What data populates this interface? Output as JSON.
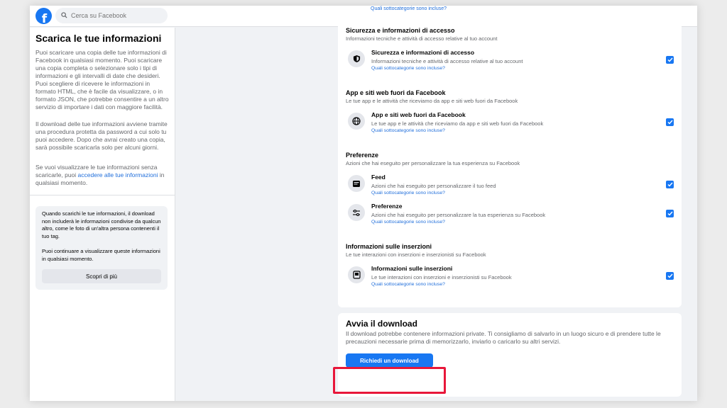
{
  "header": {
    "logo_letter": "f",
    "search_placeholder": "Cerca su Facebook",
    "nav_icons": [
      "home-icon",
      "watch-icon",
      "marketplace-icon",
      "groups-icon"
    ]
  },
  "sidebar": {
    "title": "Scarica le tue informazioni",
    "paragraph1": "Puoi scaricare una copia delle tue informazioni di Facebook in qualsiasi momento. Puoi scaricare una copia completa o selezionare solo i tipi di informazioni e gli intervalli di date che desideri. Puoi scegliere di ricevere le informazioni in formato HTML, che è facile da visualizzare, o in formato JSON, che potrebbe consentire a un altro servizio di importare i dati con maggiore facilità.",
    "paragraph2": "Il download delle tue informazioni avviene tramite una procedura protetta da password a cui solo tu puoi accedere. Dopo che avrai creato una copia, sarà possibile scaricarla solo per alcuni giorni.",
    "paragraph3_before": "Se vuoi visualizzare le tue informazioni senza scaricarle, puoi ",
    "paragraph3_link": "accedere alle tue informazioni",
    "paragraph3_after": " in qualsiasi momento.",
    "box_text1": "Quando scarichi le tue informazioni, il download non includerà le informazioni condivise da qualcun altro, come le foto di un'altra persona contenenti il tuo tag.",
    "box_text2": "Puoi continuare a visualizzare queste informazioni in qualsiasi momento.",
    "learn_more": "Scopri di più"
  },
  "categories": {
    "subcat_link": "Quali sottocategorie sono incluse?",
    "sections": [
      {
        "title": "Sicurezza e informazioni di accesso",
        "subtitle": "Informazioni tecniche e attività di accesso relative al tuo account",
        "items": [
          {
            "title": "Sicurezza e informazioni di accesso",
            "desc": "Informazioni tecniche e attività di accesso relative al tuo account",
            "icon": "shield-icon",
            "checked": true
          }
        ]
      },
      {
        "title": "App e siti web fuori da Facebook",
        "subtitle": "Le tue app e le attività che riceviamo da app e siti web fuori da Facebook",
        "items": [
          {
            "title": "App e siti web fuori da Facebook",
            "desc": "Le tue app e le attività che riceviamo da app e siti web fuori da Facebook",
            "icon": "globe-icon",
            "checked": true
          }
        ]
      },
      {
        "title": "Preferenze",
        "subtitle": "Azioni che hai eseguito per personalizzare la tua esperienza su Facebook",
        "items": [
          {
            "title": "Feed",
            "desc": "Azioni che hai eseguito per personalizzare il tuo feed",
            "icon": "feed-icon",
            "checked": true
          },
          {
            "title": "Preferenze",
            "desc": "Azioni che hai eseguito per personalizzare la tua esperienza su Facebook",
            "icon": "sliders-icon",
            "checked": true
          }
        ]
      },
      {
        "title": "Informazioni sulle inserzioni",
        "subtitle": "Le tue interazioni con inserzioni e inserzionisti su Facebook",
        "items": [
          {
            "title": "Informazioni sulle inserzioni",
            "desc": "Le tue interazioni con inserzioni e inserzionisti su Facebook",
            "icon": "ads-icon",
            "checked": true
          }
        ]
      }
    ]
  },
  "download": {
    "title": "Avvia il download",
    "text": "Il download potrebbe contenere informazioni private. Ti consigliamo di salvarlo in un luogo sicuro e di prendere tutte le precauzioni necessarie prima di memorizzarlo, inviarlo o caricarlo su altri servizi.",
    "button": "Richiedi un download"
  },
  "colors": {
    "brand": "#1877f2",
    "highlight": "#e8173a",
    "link": "#216fdb"
  }
}
